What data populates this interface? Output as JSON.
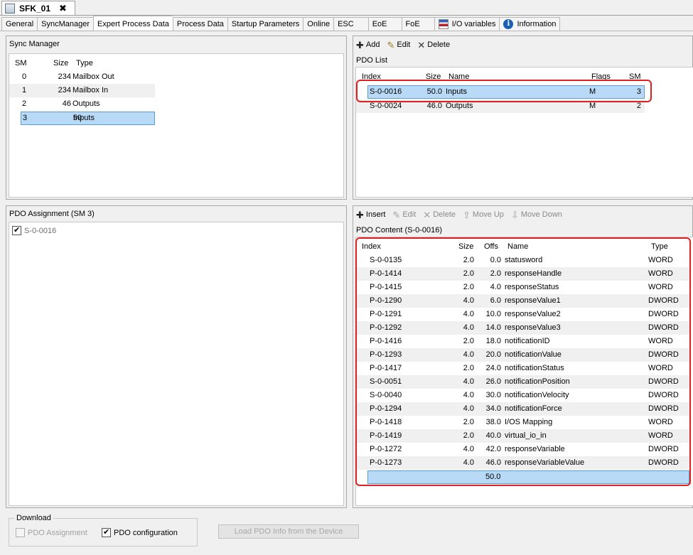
{
  "document_tab": {
    "title": "SFK_01",
    "close": "✖"
  },
  "tabs": [
    {
      "label": "General"
    },
    {
      "label": "SyncManager"
    },
    {
      "label": "Expert Process Data"
    },
    {
      "label": "Process Data"
    },
    {
      "label": "Startup Parameters"
    },
    {
      "label": "Online"
    },
    {
      "label": "ESC"
    },
    {
      "label": "EoE"
    },
    {
      "label": "FoE"
    },
    {
      "label": "I/O variables"
    },
    {
      "label": "Information"
    }
  ],
  "sync_manager": {
    "title": "Sync Manager",
    "headers": {
      "sm": "SM",
      "size": "Size",
      "type": "Type"
    },
    "rows": [
      {
        "sm": "0",
        "size": "234",
        "type": "Mailbox Out"
      },
      {
        "sm": "1",
        "size": "234",
        "type": "Mailbox In"
      },
      {
        "sm": "2",
        "size": "46",
        "type": "Outputs"
      },
      {
        "sm": "3",
        "size": "50",
        "type": "Inputs"
      }
    ]
  },
  "pdo_list_toolbar": {
    "add": "Add",
    "edit": "Edit",
    "delete": "Delete"
  },
  "pdo_list": {
    "title": "PDO List",
    "headers": {
      "index": "Index",
      "size": "Size",
      "name": "Name",
      "flags": "Flags",
      "sm": "SM"
    },
    "rows": [
      {
        "index": "S-0-0016",
        "size": "50.0",
        "name": "Inputs",
        "flags": "M",
        "sm": "3"
      },
      {
        "index": "S-0-0024",
        "size": "46.0",
        "name": "Outputs",
        "flags": "M",
        "sm": "2"
      }
    ]
  },
  "pdo_assignment": {
    "title": "PDO Assignment (SM 3)",
    "items": [
      {
        "label": "S-0-0016",
        "checked": true
      }
    ]
  },
  "pdo_content_toolbar": {
    "insert": "Insert",
    "edit": "Edit",
    "delete": "Delete",
    "move_up": "Move Up",
    "move_down": "Move Down"
  },
  "pdo_content": {
    "title": "PDO Content (S-0-0016)",
    "headers": {
      "index": "Index",
      "size": "Size",
      "offs": "Offs",
      "name": "Name",
      "type": "Type"
    },
    "rows": [
      {
        "index": "S-0-0135",
        "size": "2.0",
        "offs": "0.0",
        "name": "statusword",
        "type": "WORD"
      },
      {
        "index": "P-0-1414",
        "size": "2.0",
        "offs": "2.0",
        "name": "responseHandle",
        "type": "WORD"
      },
      {
        "index": "P-0-1415",
        "size": "2.0",
        "offs": "4.0",
        "name": "responseStatus",
        "type": "WORD"
      },
      {
        "index": "P-0-1290",
        "size": "4.0",
        "offs": "6.0",
        "name": "responseValue1",
        "type": "DWORD"
      },
      {
        "index": "P-0-1291",
        "size": "4.0",
        "offs": "10.0",
        "name": "responseValue2",
        "type": "DWORD"
      },
      {
        "index": "P-0-1292",
        "size": "4.0",
        "offs": "14.0",
        "name": "responseValue3",
        "type": "DWORD"
      },
      {
        "index": "P-0-1416",
        "size": "2.0",
        "offs": "18.0",
        "name": "notificationID",
        "type": "WORD"
      },
      {
        "index": "P-0-1293",
        "size": "4.0",
        "offs": "20.0",
        "name": "notificationValue",
        "type": "DWORD"
      },
      {
        "index": "P-0-1417",
        "size": "2.0",
        "offs": "24.0",
        "name": "notificationStatus",
        "type": "WORD"
      },
      {
        "index": "S-0-0051",
        "size": "4.0",
        "offs": "26.0",
        "name": "notificationPosition",
        "type": "DWORD"
      },
      {
        "index": "S-0-0040",
        "size": "4.0",
        "offs": "30.0",
        "name": "notificationVelocity",
        "type": "DWORD"
      },
      {
        "index": "P-0-1294",
        "size": "4.0",
        "offs": "34.0",
        "name": "notificationForce",
        "type": "DWORD"
      },
      {
        "index": "P-0-1418",
        "size": "2.0",
        "offs": "38.0",
        "name": "I/OS Mapping",
        "type": "WORD"
      },
      {
        "index": "P-0-1419",
        "size": "2.0",
        "offs": "40.0",
        "name": "virtual_io_in",
        "type": "WORD"
      },
      {
        "index": "P-0-1272",
        "size": "4.0",
        "offs": "42.0",
        "name": "responseVariable",
        "type": "DWORD"
      },
      {
        "index": "P-0-1273",
        "size": "4.0",
        "offs": "46.0",
        "name": "responseVariableValue",
        "type": "DWORD"
      }
    ],
    "total_offs": "50.0"
  },
  "download": {
    "title": "Download",
    "pdo_assignment_label": "PDO Assignment",
    "pdo_assignment_checked": false,
    "pdo_configuration_label": "PDO configuration",
    "pdo_configuration_checked": true
  },
  "load_button": "Load PDO Info from the Device"
}
